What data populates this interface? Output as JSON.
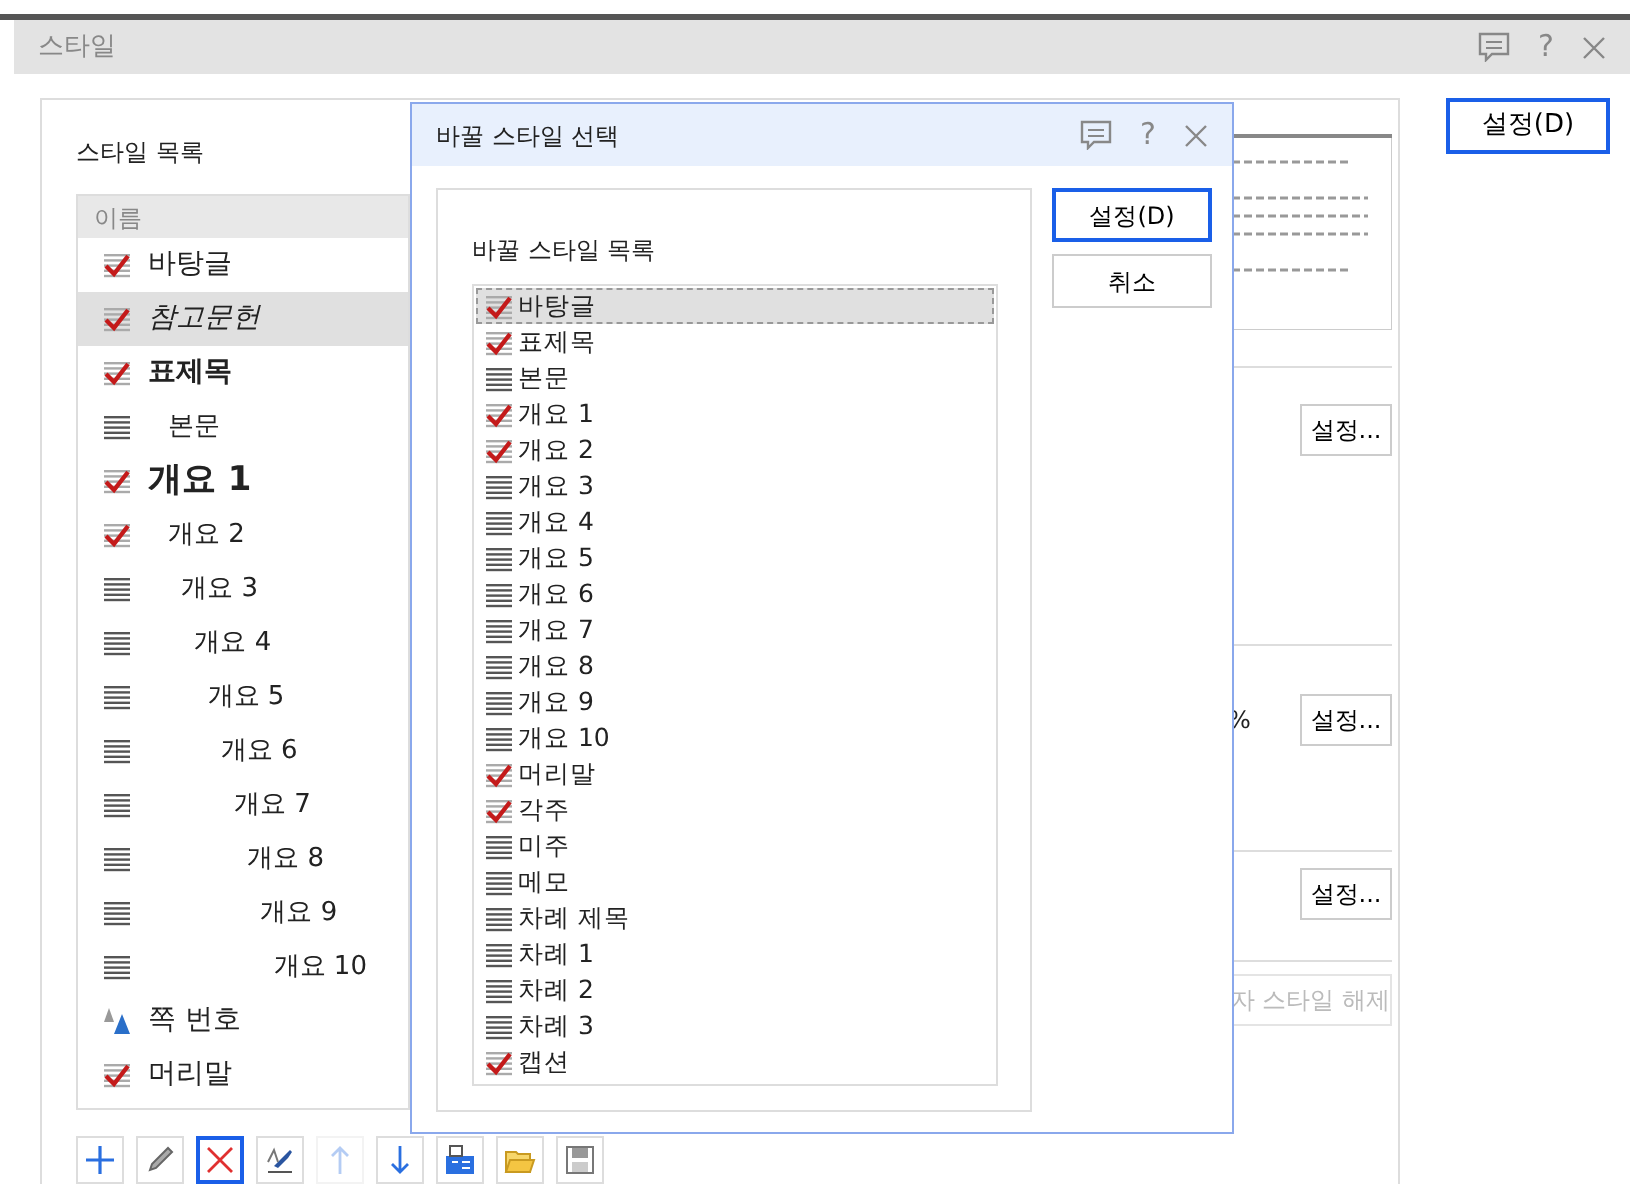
{
  "window": {
    "title": "스타일",
    "help": "?"
  },
  "style_list": {
    "label": "스타일 목록",
    "column": "이름",
    "items": [
      {
        "name": "바탕글",
        "kind": "regular",
        "checked": true,
        "selected": false
      },
      {
        "name": "참고문헌",
        "kind": "italic",
        "checked": true,
        "selected": true
      },
      {
        "name": "표제목",
        "kind": "bold",
        "checked": true,
        "selected": false
      },
      {
        "name": "본문",
        "kind": "body",
        "checked": false,
        "selected": false
      },
      {
        "name": "개요 1",
        "kind": "heading",
        "checked": true,
        "selected": false
      },
      {
        "name": "개요 2",
        "kind": "outline",
        "checked": true,
        "selected": false
      },
      {
        "name": "개요 3",
        "kind": "outline",
        "checked": false,
        "selected": false
      },
      {
        "name": "개요 4",
        "kind": "outline",
        "checked": false,
        "selected": false
      },
      {
        "name": "개요 5",
        "kind": "outline",
        "checked": false,
        "selected": false
      },
      {
        "name": "개요 6",
        "kind": "outline",
        "checked": false,
        "selected": false
      },
      {
        "name": "개요 7",
        "kind": "outline",
        "checked": false,
        "selected": false
      },
      {
        "name": "개요 8",
        "kind": "outline",
        "checked": false,
        "selected": false
      },
      {
        "name": "개요 9",
        "kind": "outline",
        "checked": false,
        "selected": false
      },
      {
        "name": "개요 10",
        "kind": "outline",
        "checked": false,
        "selected": false
      },
      {
        "name": "쪽 번호",
        "kind": "character",
        "selected": false
      },
      {
        "name": "머리말",
        "kind": "regular",
        "checked": true,
        "selected": false
      }
    ],
    "toolbar": [
      {
        "kind": "add",
        "disabled": false,
        "selected": false
      },
      {
        "kind": "edit",
        "disabled": false,
        "selected": false
      },
      {
        "kind": "delete",
        "disabled": false,
        "selected": true
      },
      {
        "kind": "pick",
        "disabled": false,
        "selected": false
      },
      {
        "kind": "up",
        "disabled": true,
        "selected": false
      },
      {
        "kind": "down",
        "disabled": false,
        "selected": false
      },
      {
        "kind": "import",
        "disabled": false,
        "selected": false
      },
      {
        "kind": "open",
        "disabled": false,
        "selected": false
      },
      {
        "kind": "save",
        "disabled": false,
        "selected": false
      }
    ]
  },
  "details": {
    "sections": [
      {
        "button": "설정..."
      },
      {
        "reading": "%",
        "button": "설정..."
      },
      {
        "button": "설정..."
      }
    ],
    "release_button": {
      "label": "자 스타일 해제",
      "disabled": true
    }
  },
  "ok_button": {
    "label": "설정(D)"
  },
  "dialog": {
    "title": "바꿀 스타일 선택",
    "help": "?",
    "list_label": "바꿀 스타일 목록",
    "items": [
      {
        "name": "바탕글",
        "checked": true,
        "selected": true
      },
      {
        "name": "표제목",
        "checked": true,
        "selected": false
      },
      {
        "name": "본문",
        "checked": false,
        "selected": false
      },
      {
        "name": "개요 1",
        "checked": true,
        "selected": false
      },
      {
        "name": "개요 2",
        "checked": true,
        "selected": false
      },
      {
        "name": "개요 3",
        "checked": false,
        "selected": false
      },
      {
        "name": "개요 4",
        "checked": false,
        "selected": false
      },
      {
        "name": "개요 5",
        "checked": false,
        "selected": false
      },
      {
        "name": "개요 6",
        "checked": false,
        "selected": false
      },
      {
        "name": "개요 7",
        "checked": false,
        "selected": false
      },
      {
        "name": "개요 8",
        "checked": false,
        "selected": false
      },
      {
        "name": "개요 9",
        "checked": false,
        "selected": false
      },
      {
        "name": "개요 10",
        "checked": false,
        "selected": false
      },
      {
        "name": "머리말",
        "checked": true,
        "selected": false
      },
      {
        "name": "각주",
        "checked": true,
        "selected": false
      },
      {
        "name": "미주",
        "checked": false,
        "selected": false
      },
      {
        "name": "메모",
        "checked": false,
        "selected": false
      },
      {
        "name": "차례 제목",
        "checked": false,
        "selected": false
      },
      {
        "name": "차례 1",
        "checked": false,
        "selected": false
      },
      {
        "name": "차례 2",
        "checked": false,
        "selected": false
      },
      {
        "name": "차례 3",
        "checked": false,
        "selected": false
      },
      {
        "name": "캡션",
        "checked": true,
        "selected": false
      }
    ],
    "buttons": [
      {
        "label": "설정(D)",
        "default": true
      },
      {
        "label": "취소",
        "default": false
      }
    ]
  }
}
